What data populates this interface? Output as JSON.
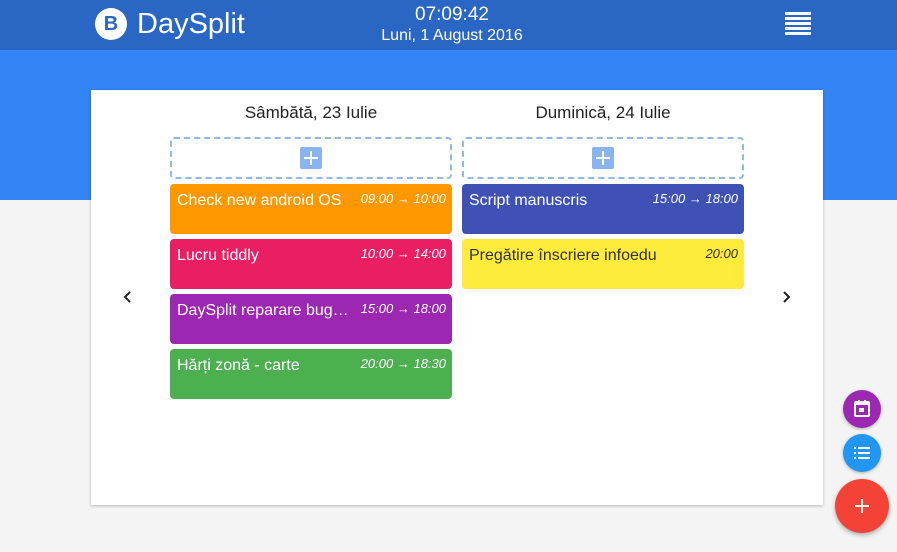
{
  "app": {
    "name": "DaySplit",
    "logo_letter": "B"
  },
  "header": {
    "time": "07:09:42",
    "date": "Luni, 1 August 2016"
  },
  "days": [
    {
      "title": "Sâmbătă, 23 Iulie",
      "events": [
        {
          "title": "Check new android OS",
          "time": "09:00 → 10:00",
          "color": "#ff9800",
          "text_color": "#ffffff"
        },
        {
          "title": "Lucru tiddly",
          "time": "10:00 → 14:00",
          "color": "#e91e63",
          "text_color": "#ffffff"
        },
        {
          "title": "DaySplit reparare bug…",
          "time": "15:00 → 18:00",
          "color": "#9c27b0",
          "text_color": "#ffffff"
        },
        {
          "title": "Hărți zonă - carte",
          "time": "20:00 → 18:30",
          "color": "#4caf50",
          "text_color": "#ffffff"
        }
      ]
    },
    {
      "title": "Duminică, 24 Iulie",
      "events": [
        {
          "title": "Script manuscris",
          "time": "15:00 → 18:00",
          "color": "#3f51b5",
          "text_color": "#ffffff"
        },
        {
          "title": "Pregătire înscriere infoedu",
          "time": "20:00",
          "color": "#ffeb3b",
          "text_color": "#333333"
        }
      ]
    }
  ],
  "colors": {
    "topbar": "#2a67c4",
    "accent": "#3385f5",
    "fab_calendar": "#9c27b0",
    "fab_list": "#2196f3",
    "fab_add": "#f44336"
  },
  "icons": {
    "menu": "menu-icon",
    "prev": "chevron-left-icon",
    "next": "chevron-right-icon",
    "calendar": "calendar-icon",
    "list": "list-icon",
    "add": "plus-icon"
  }
}
